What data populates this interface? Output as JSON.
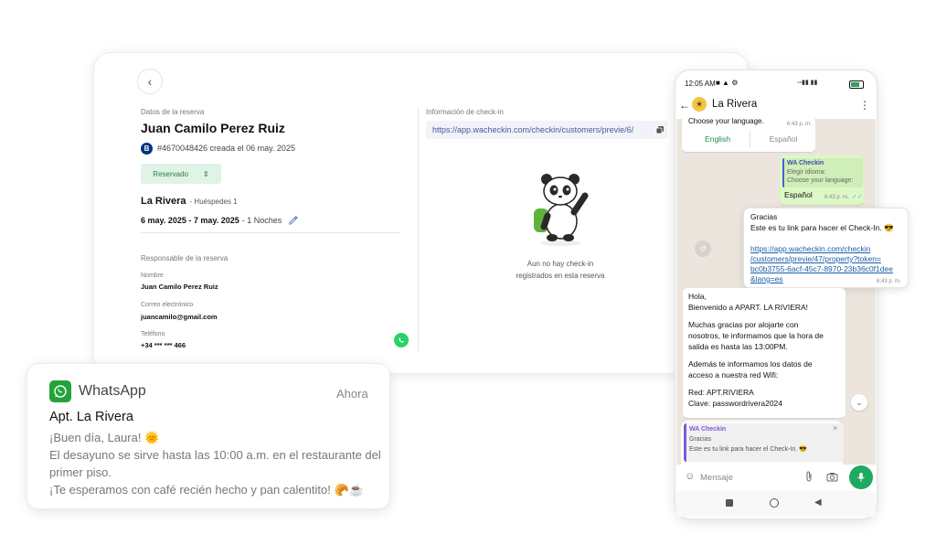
{
  "desktop": {
    "reservation_section_label": "Datos de la reserva",
    "guest_name": "Juan Camilo Perez Ruiz",
    "booking_badge": "B",
    "reservation_id": "#4670048426 creada el 06 may. 2025",
    "status": "Reservado",
    "property_name": "La Rivera",
    "guests": "- Huéspedes 1",
    "dates": "6 may. 2025 - 7 may. 2025",
    "nights": "- 1 Noches",
    "responsible_label": "Responsable de la reserva",
    "name_label": "Nombre",
    "name_value": "Juan Camilo Perez Ruiz",
    "email_label": "Correo electrónico",
    "email_value": "juancamilo@gmail.com",
    "phone_label": "Teléfono",
    "phone_value": "+34 *** *** 466",
    "checkin_info_label": "Información de check-in",
    "checkin_url": "https://app.wacheckin.com/checkin/customers/previe/6/",
    "empty_line1": "Aun no hay check-in",
    "empty_line2": "registrados en esta reserva"
  },
  "notification": {
    "app_name": "WhatsApp",
    "time": "Ahora",
    "title": "Apt. La Rivera",
    "line1": "¡Buen día, Laura! 🌞",
    "line2": "El desayuno se sirve hasta las 10:00 a.m. en el restaurante del",
    "line3": "primer piso.",
    "line4": "¡Te esperamos con café recién hecho y pan calentito! 🥐☕"
  },
  "phone": {
    "status_time": "12:05 AM",
    "contact_name": "La Rivera",
    "msg_language": "Choose your language.",
    "ts_1": "6:43 p. m.",
    "btn_english": "English",
    "btn_espanol": "Español",
    "quoted_sender": "WA Checkin",
    "quoted_line1": "Elegir idioma:",
    "quoted_line2": "Choose your language:",
    "reply_espanol": "Español",
    "ts_2": "6:43 p. m.",
    "msg_gracias": "Gracias",
    "msg_link_intro": "Este es tu link para hacer el Check-In. 😎",
    "link_1": "https://app.wacheckin.com/checkin",
    "link_2": "/customers/previe/47/property?token=",
    "link_3": "bc0b3755-6acf-45c7-8970-23b36c0f1dee",
    "link_4": "&lang=es",
    "ts_3": "6:43 p. m.",
    "welcome_1": "Hola,",
    "welcome_2": "Bienvenido a APART. LA RIVIERA!",
    "welcome_3": "Muchas gracias por alojarte con",
    "welcome_4": "nosotros, te informamos que la hora de",
    "welcome_5": "salida es hasta las 13:00PM.",
    "welcome_6": "Además te informamos los datos de",
    "welcome_7": "acceso a nuestra red Wifi:",
    "welcome_8": "Red: APT.RIVIERA",
    "welcome_9": "Clave: passwordrivera2024",
    "reply_sender": "WA Checkin",
    "reply_line1": "Gracias",
    "reply_line2": "Este es tu link para hacer el Check-In. 😎",
    "input_placeholder": "Mensaje",
    "colors": {
      "accent": "#25d366",
      "bubble_out": "#dcf8c6",
      "chat_bg": "#ebe5dd"
    }
  }
}
